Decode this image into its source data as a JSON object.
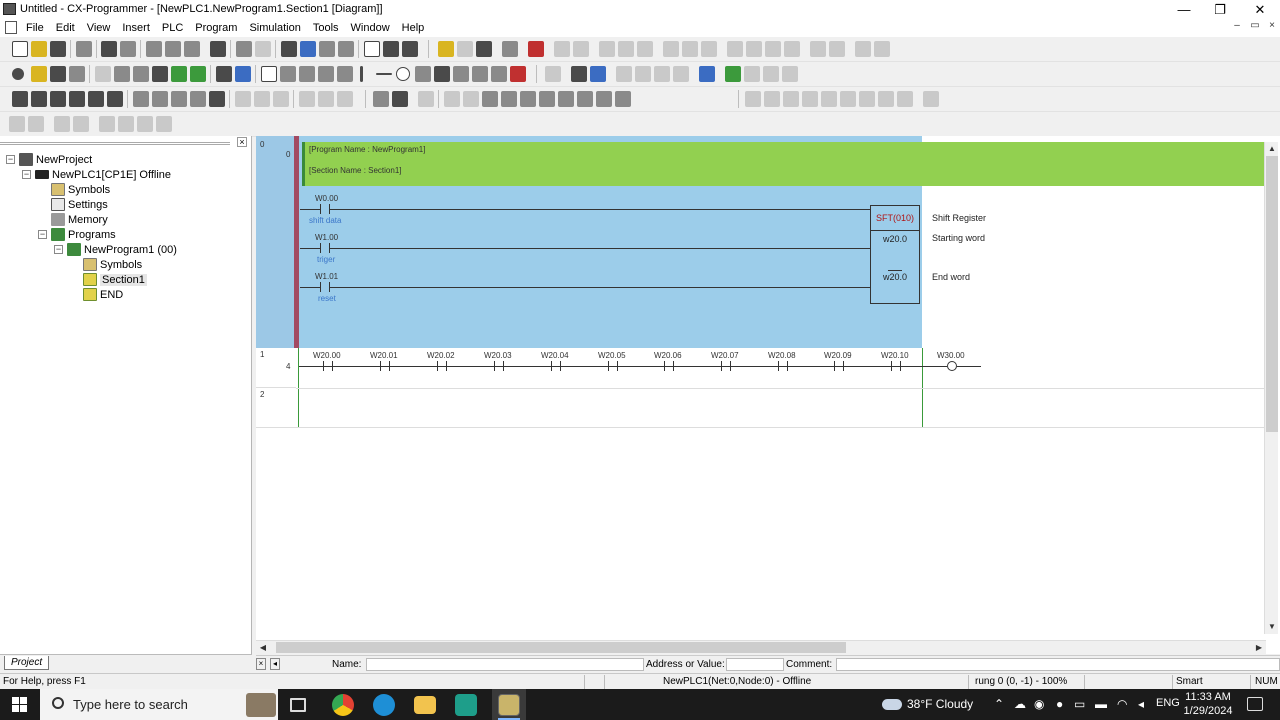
{
  "window": {
    "title": "Untitled - CX-Programmer - [NewPLC1.NewProgram1.Section1 [Diagram]]",
    "min": "—",
    "restore": "❐",
    "close": "✕",
    "mdi_min": "–",
    "mdi_restore": "▭",
    "mdi_close": "×"
  },
  "menu": [
    "File",
    "Edit",
    "View",
    "Insert",
    "PLC",
    "Program",
    "Simulation",
    "Tools",
    "Window",
    "Help"
  ],
  "tree": {
    "close": "×",
    "nodes": [
      {
        "label": "NewProject"
      },
      {
        "label": "NewPLC1[CP1E] Offline"
      },
      {
        "label": "Symbols"
      },
      {
        "label": "Settings"
      },
      {
        "label": "Memory"
      },
      {
        "label": "Programs"
      },
      {
        "label": "NewProgram1 (00)"
      },
      {
        "label": "Symbols"
      },
      {
        "label": "Section1"
      },
      {
        "label": "END"
      }
    ],
    "tab": "Project"
  },
  "diagram": {
    "rung0": {
      "number": "0",
      "step": "0",
      "program_name": "[Program Name : NewProgram1]",
      "section_name": "[Section Name : Section1]",
      "contacts": [
        {
          "address": "W0.00",
          "comment": "shift data"
        },
        {
          "address": "W1.00",
          "comment": "triger"
        },
        {
          "address": "W1.01",
          "comment": "reset"
        }
      ],
      "instruction": "SFT(010)",
      "operand1": "w20.0",
      "operand2": "w20.0",
      "comments": [
        "Shift Register",
        "Starting word",
        "End word"
      ]
    },
    "rung1": {
      "number": "1",
      "step": "4",
      "contacts": [
        "W20.00",
        "W20.01",
        "W20.02",
        "W20.03",
        "W20.04",
        "W20.05",
        "W20.06",
        "W20.07",
        "W20.08",
        "W20.09",
        "W20.10"
      ],
      "coil": "W30.00"
    },
    "rung2": {
      "number": "2"
    }
  },
  "namebar": {
    "name_label": "Name:",
    "address_label": "Address or Value:",
    "comment_label": "Comment:"
  },
  "status": {
    "help": "For Help, press F1",
    "network": "NewPLC1(Net:0,Node:0) - Offline",
    "rung": "rung 0 (0, -1)  - 100%",
    "mode": "Smart",
    "num": "NUM"
  },
  "taskbar": {
    "search_placeholder": "Type here to search",
    "weather": "38°F  Cloudy",
    "lang": "ENG",
    "time": "11:33 AM",
    "date": "1/29/2024"
  }
}
